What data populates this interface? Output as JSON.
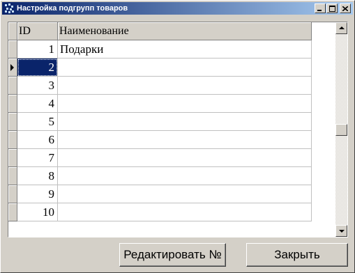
{
  "window": {
    "title": "Настройка подгрупп товаров"
  },
  "grid": {
    "columns": [
      "ID",
      "Наименование"
    ],
    "rows": [
      {
        "id": "1",
        "name": "Подарки"
      },
      {
        "id": "2",
        "name": ""
      },
      {
        "id": "3",
        "name": ""
      },
      {
        "id": "4",
        "name": ""
      },
      {
        "id": "5",
        "name": ""
      },
      {
        "id": "6",
        "name": ""
      },
      {
        "id": "7",
        "name": ""
      },
      {
        "id": "8",
        "name": ""
      },
      {
        "id": "9",
        "name": ""
      },
      {
        "id": "10",
        "name": ""
      }
    ],
    "selected_row": 2
  },
  "buttons": {
    "edit_label": "Редактировать №",
    "close_label": "Закрыть"
  },
  "icons": {
    "window": "app-icon",
    "minimize": "minimize-icon",
    "maximize": "maximize-icon",
    "close": "close-icon",
    "row_pointer": "row-pointer-icon",
    "scroll_up": "scroll-up-icon",
    "scroll_down": "scroll-down-icon"
  },
  "colors": {
    "title_start": "#0a246a",
    "title_end": "#a6caf0",
    "selection": "#0a246a",
    "face": "#d4d0c8"
  }
}
